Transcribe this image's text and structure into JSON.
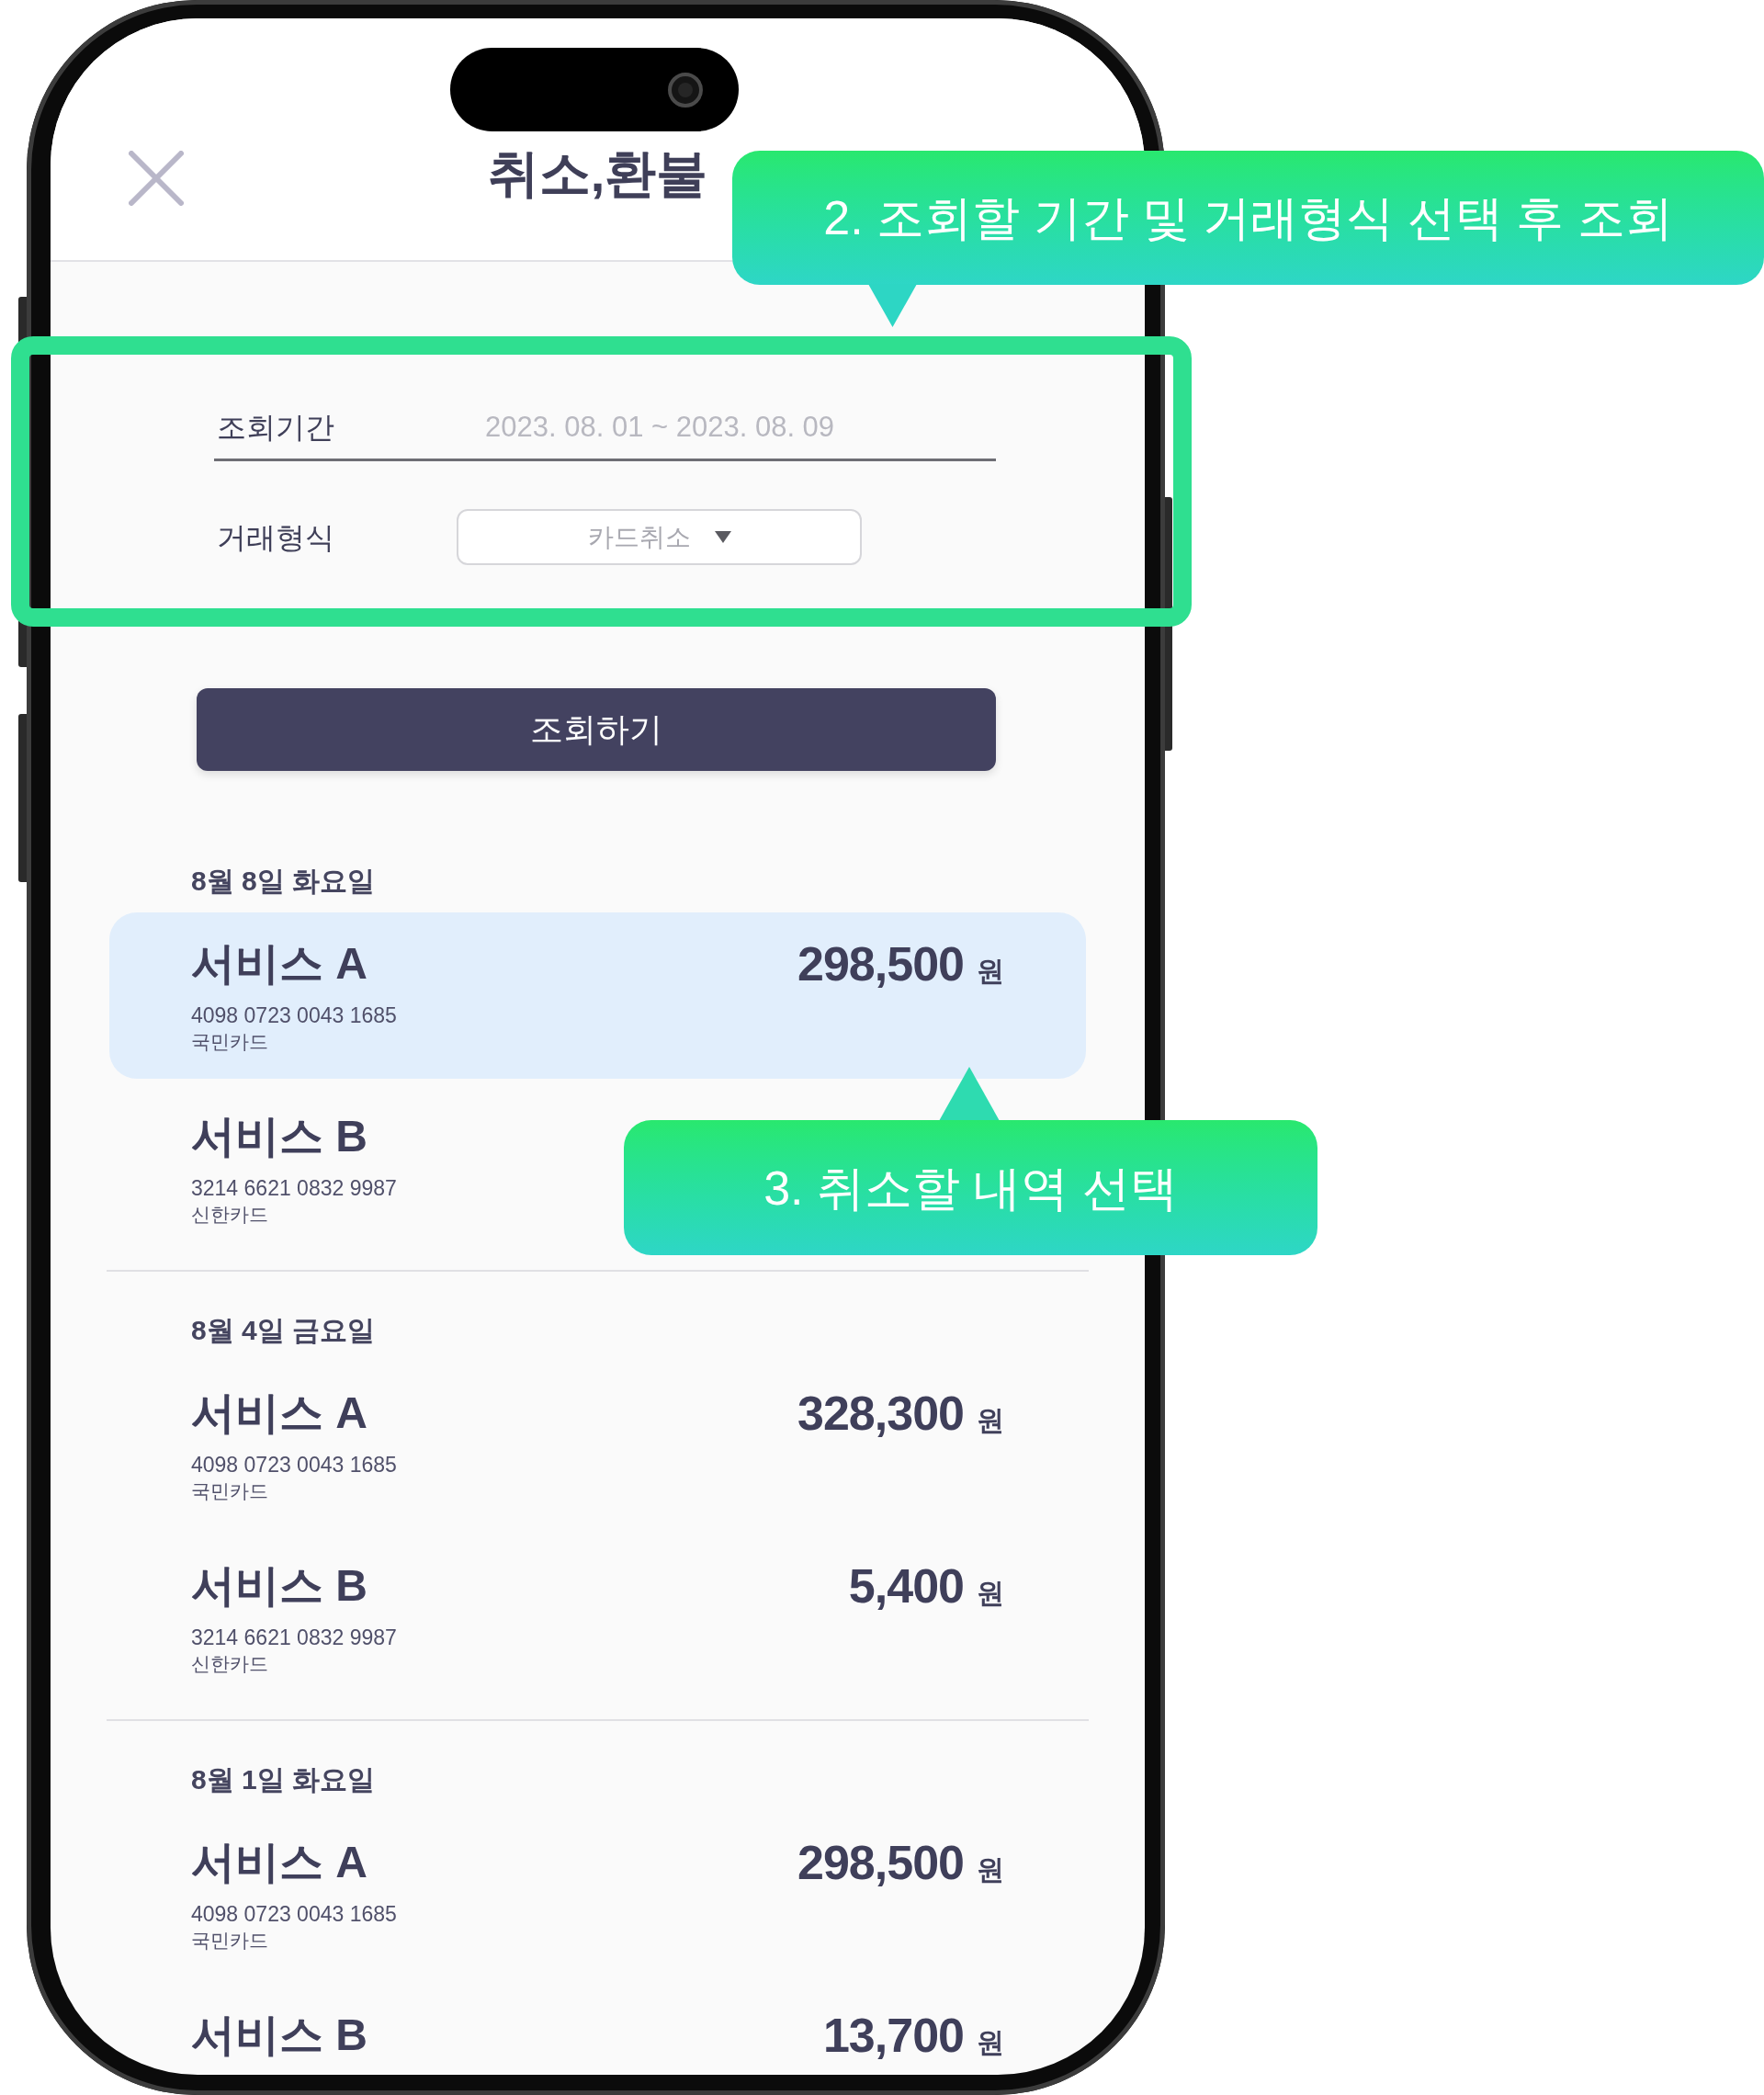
{
  "header": {
    "title": "취소,환불"
  },
  "filter": {
    "period": {
      "label": "조회기간",
      "value": "2023. 08. 01 ~ 2023. 08. 09"
    },
    "transaction_type": {
      "label": "거래형식",
      "value": "카드취소"
    },
    "search_button": "조회하기"
  },
  "groups": [
    {
      "date": "8월 8일 화요일",
      "items": [
        {
          "service": "서비스 A",
          "amount": "298,500",
          "currency": "원",
          "card_number": "4098 0723 0043 1685",
          "issuer": "국민카드",
          "selected": true
        },
        {
          "service": "서비스 B",
          "card_number": "3214 6621 0832 9987",
          "issuer": "신한카드",
          "selected": false
        }
      ]
    },
    {
      "date": "8월 4일 금요일",
      "items": [
        {
          "service": "서비스 A",
          "amount": "328,300",
          "currency": "원",
          "card_number": "4098 0723 0043 1685",
          "issuer": "국민카드",
          "selected": false
        },
        {
          "service": "서비스 B",
          "amount": "5,400",
          "currency": "원",
          "card_number": "3214 6621 0832 9987",
          "issuer": "신한카드",
          "selected": false
        }
      ]
    },
    {
      "date": "8월 1일 화요일",
      "items": [
        {
          "service": "서비스 A",
          "amount": "298,500",
          "currency": "원",
          "card_number": "4098 0723 0043 1685",
          "issuer": "국민카드",
          "selected": false
        },
        {
          "service": "서비스 B",
          "amount": "13,700",
          "currency": "원",
          "selected": false
        }
      ]
    }
  ],
  "callouts": [
    {
      "text": "2. 조회할 기간 및 거래형식 선택 후 조회"
    },
    {
      "text": "3. 취소할 내역 선택"
    }
  ]
}
